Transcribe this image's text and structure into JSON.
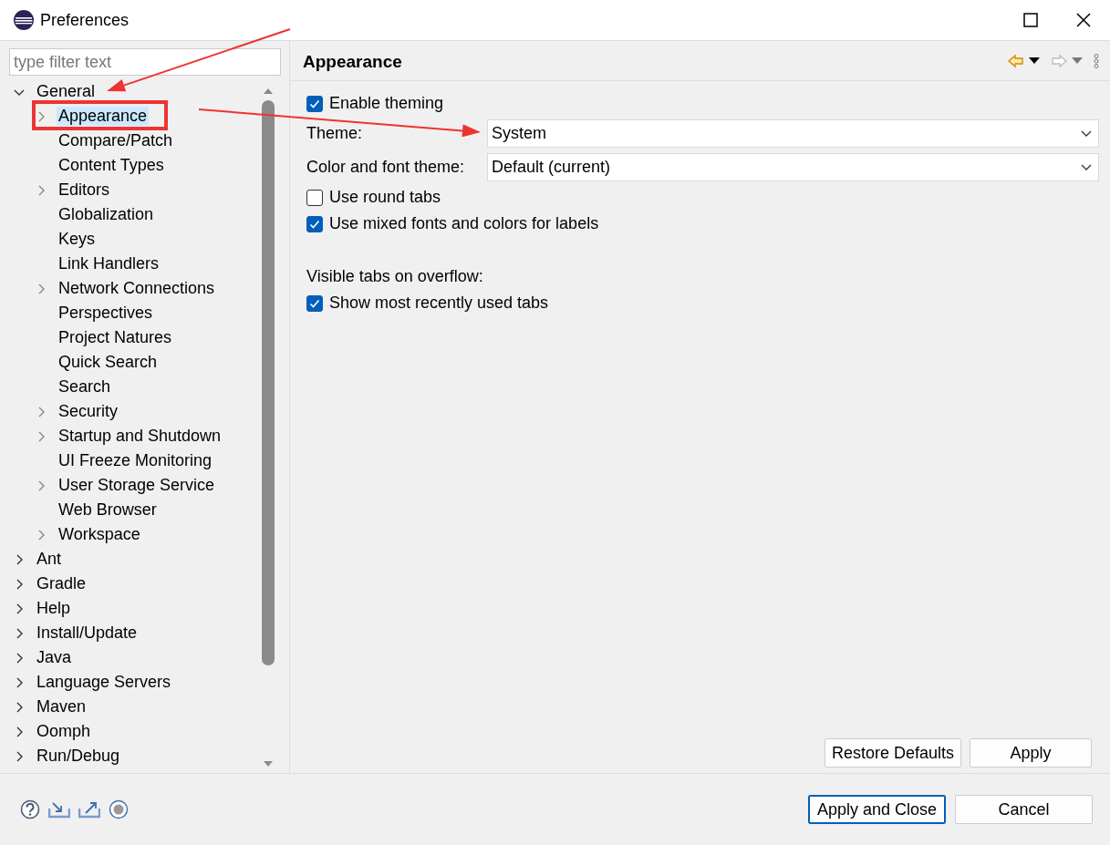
{
  "window": {
    "title": "Preferences"
  },
  "filter": {
    "placeholder": "type filter text"
  },
  "tree": [
    {
      "label": "General",
      "kind": "branch",
      "expanded": true,
      "selected": false,
      "children": [
        {
          "label": "Appearance",
          "kind": "branch",
          "expanded": false,
          "selected": true
        },
        {
          "label": "Compare/Patch",
          "kind": "leaf",
          "selected": false
        },
        {
          "label": "Content Types",
          "kind": "leaf",
          "selected": false
        },
        {
          "label": "Editors",
          "kind": "branch",
          "expanded": false,
          "selected": false
        },
        {
          "label": "Globalization",
          "kind": "leaf",
          "selected": false
        },
        {
          "label": "Keys",
          "kind": "leaf",
          "selected": false
        },
        {
          "label": "Link Handlers",
          "kind": "leaf",
          "selected": false
        },
        {
          "label": "Network Connections",
          "kind": "branch",
          "expanded": false,
          "selected": false
        },
        {
          "label": "Perspectives",
          "kind": "leaf",
          "selected": false
        },
        {
          "label": "Project Natures",
          "kind": "leaf",
          "selected": false
        },
        {
          "label": "Quick Search",
          "kind": "leaf",
          "selected": false
        },
        {
          "label": "Search",
          "kind": "leaf",
          "selected": false
        },
        {
          "label": "Security",
          "kind": "branch",
          "expanded": false,
          "selected": false
        },
        {
          "label": "Startup and Shutdown",
          "kind": "branch",
          "expanded": false,
          "selected": false
        },
        {
          "label": "UI Freeze Monitoring",
          "kind": "leaf",
          "selected": false
        },
        {
          "label": "User Storage Service",
          "kind": "branch",
          "expanded": false,
          "selected": false
        },
        {
          "label": "Web Browser",
          "kind": "leaf",
          "selected": false
        },
        {
          "label": "Workspace",
          "kind": "branch",
          "expanded": false,
          "selected": false
        }
      ]
    },
    {
      "label": "Ant",
      "kind": "branch",
      "expanded": false,
      "selected": false
    },
    {
      "label": "Gradle",
      "kind": "branch",
      "expanded": false,
      "selected": false
    },
    {
      "label": "Help",
      "kind": "branch",
      "expanded": false,
      "selected": false
    },
    {
      "label": "Install/Update",
      "kind": "branch",
      "expanded": false,
      "selected": false
    },
    {
      "label": "Java",
      "kind": "branch",
      "expanded": false,
      "selected": false
    },
    {
      "label": "Language Servers",
      "kind": "branch",
      "expanded": false,
      "selected": false
    },
    {
      "label": "Maven",
      "kind": "branch",
      "expanded": false,
      "selected": false
    },
    {
      "label": "Oomph",
      "kind": "branch",
      "expanded": false,
      "selected": false
    },
    {
      "label": "Run/Debug",
      "kind": "branch",
      "expanded": false,
      "selected": false
    }
  ],
  "page": {
    "title": "Appearance",
    "settings": [
      {
        "kind": "checkbox",
        "label": "Enable theming",
        "checked": true
      },
      {
        "kind": "combo",
        "label": "Theme:",
        "value": "System"
      },
      {
        "kind": "combo",
        "label": "Color and font theme:",
        "value": "Default (current)"
      },
      {
        "kind": "checkbox",
        "label": "Use round tabs",
        "checked": false
      },
      {
        "kind": "checkbox",
        "label": "Use mixed fonts and colors for labels",
        "checked": true
      },
      {
        "kind": "heading",
        "label": "Visible tabs on overflow:"
      },
      {
        "kind": "checkbox",
        "label": "Show most recently used tabs",
        "checked": true
      }
    ],
    "buttons": [
      "Restore Defaults",
      "Apply"
    ]
  },
  "footer": {
    "buttons": [
      {
        "label": "Apply and Close",
        "default": true
      },
      {
        "label": "Cancel",
        "default": false
      }
    ]
  },
  "annotations": [
    {
      "kind": "box"
    },
    {
      "kind": "arrow"
    },
    {
      "kind": "arrow"
    }
  ]
}
